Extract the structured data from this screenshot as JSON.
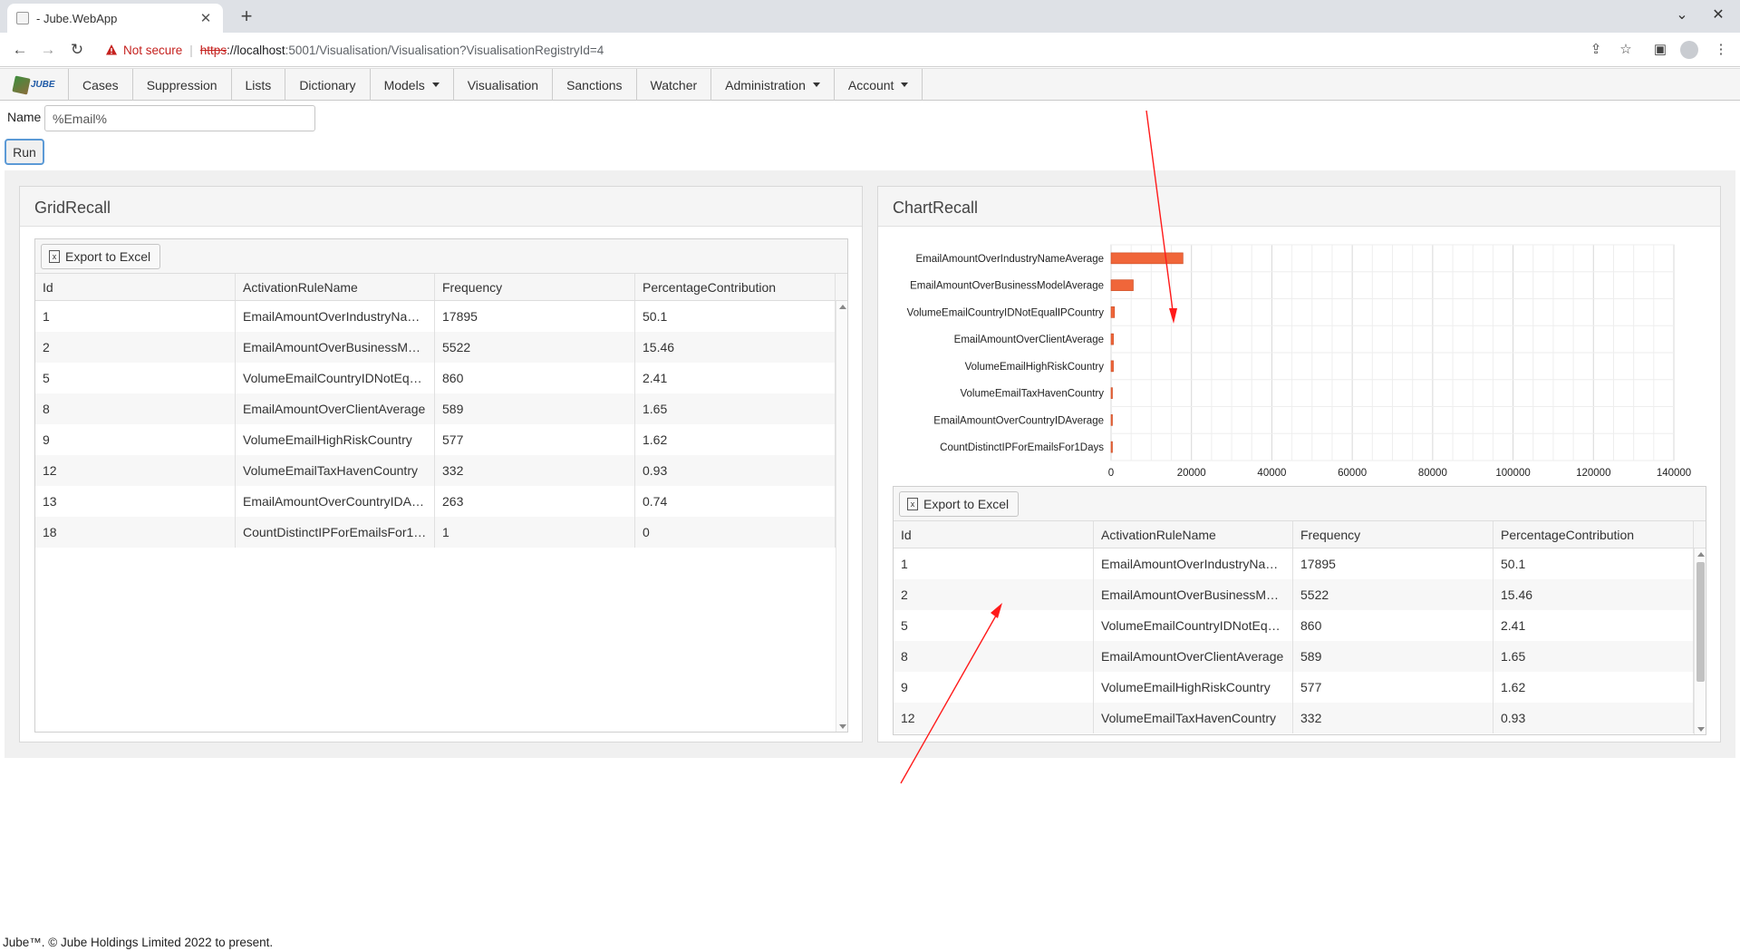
{
  "browser": {
    "tab_title": "- Jube.WebApp",
    "security_label": "Not secure",
    "url_scheme": "https",
    "url_host": "://localhost",
    "url_rest": ":5001/Visualisation/Visualisation?VisualisationRegistryId=4"
  },
  "nav": {
    "brand": "JUBE",
    "items": [
      "Cases",
      "Suppression",
      "Lists",
      "Dictionary",
      "Models",
      "Visualisation",
      "Sanctions",
      "Watcher",
      "Administration",
      "Account"
    ]
  },
  "form": {
    "name_label": "Name",
    "name_value": "%Email%",
    "run_label": "Run"
  },
  "grid_panel": {
    "title": "GridRecall",
    "export_label": "Export to Excel",
    "columns": [
      "Id",
      "ActivationRuleName",
      "Frequency",
      "PercentageContribution"
    ],
    "rows": [
      [
        "1",
        "EmailAmountOverIndustryNa…",
        "17895",
        "50.1"
      ],
      [
        "2",
        "EmailAmountOverBusinessM…",
        "5522",
        "15.46"
      ],
      [
        "5",
        "VolumeEmailCountryIDNotEq…",
        "860",
        "2.41"
      ],
      [
        "8",
        "EmailAmountOverClientAverage",
        "589",
        "1.65"
      ],
      [
        "9",
        "VolumeEmailHighRiskCountry",
        "577",
        "1.62"
      ],
      [
        "12",
        "VolumeEmailTaxHavenCountry",
        "332",
        "0.93"
      ],
      [
        "13",
        "EmailAmountOverCountryIDA…",
        "263",
        "0.74"
      ],
      [
        "18",
        "CountDistinctIPForEmailsFor1…",
        "1",
        "0"
      ]
    ]
  },
  "chart_panel": {
    "title": "ChartRecall",
    "export_label": "Export to Excel",
    "columns": [
      "Id",
      "ActivationRuleName",
      "Frequency",
      "PercentageContribution"
    ],
    "rows": [
      [
        "1",
        "EmailAmountOverIndustryNa…",
        "17895",
        "50.1"
      ],
      [
        "2",
        "EmailAmountOverBusinessM…",
        "5522",
        "15.46"
      ],
      [
        "5",
        "VolumeEmailCountryIDNotEq…",
        "860",
        "2.41"
      ],
      [
        "8",
        "EmailAmountOverClientAverage",
        "589",
        "1.65"
      ],
      [
        "9",
        "VolumeEmailHighRiskCountry",
        "577",
        "1.62"
      ],
      [
        "12",
        "VolumeEmailTaxHavenCountry",
        "332",
        "0.93"
      ]
    ]
  },
  "chart_data": {
    "type": "bar",
    "orientation": "horizontal",
    "categories": [
      "EmailAmountOverIndustryNameAverage",
      "EmailAmountOverBusinessModelAverage",
      "VolumeEmailCountryIDNotEqualIPCountry",
      "EmailAmountOverClientAverage",
      "VolumeEmailHighRiskCountry",
      "VolumeEmailTaxHavenCountry",
      "EmailAmountOverCountryIDAverage",
      "CountDistinctIPForEmailsFor1Days"
    ],
    "values": [
      17895,
      5522,
      860,
      589,
      577,
      332,
      263,
      1
    ],
    "xlim": [
      0,
      140000
    ],
    "xticks": [
      "0",
      "20000",
      "40000",
      "60000",
      "80000",
      "100000",
      "120000",
      "140000"
    ],
    "bar_color": "#f0663a",
    "grid": true
  },
  "footer": {
    "text": "Jube™. © Jube Holdings Limited 2022 to present."
  }
}
